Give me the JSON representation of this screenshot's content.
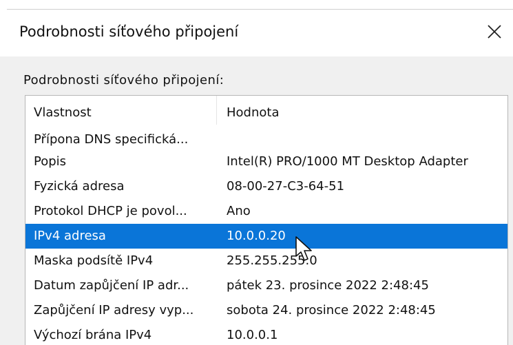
{
  "window": {
    "title": "Podrobnosti síťového připojení",
    "close_icon": "close-icon"
  },
  "group": {
    "label": "Podrobnosti síťového připojení:"
  },
  "table": {
    "columns": [
      "Vlastnost",
      "Hodnota"
    ],
    "rows": [
      {
        "property": "Přípona DNS specifická...",
        "value": ""
      },
      {
        "property": "Popis",
        "value": "Intel(R) PRO/1000 MT Desktop Adapter"
      },
      {
        "property": "Fyzická adresa",
        "value": "08-00-27-C3-64-51"
      },
      {
        "property": "Protokol DHCP je povol...",
        "value": "Ano"
      },
      {
        "property": "IPv4 adresa",
        "value": "10.0.0.20"
      },
      {
        "property": "Maska podsítě IPv4",
        "value": "255.255.255.0"
      },
      {
        "property": "Datum zapůjčení IP adr...",
        "value": "pátek 23. prosince 2022 2:48:45"
      },
      {
        "property": "Zapůjčení IP adresy vyp...",
        "value": "sobota 24. prosince 2022 2:48:45"
      },
      {
        "property": "Výchozí brána IPv4",
        "value": "10.0.0.1"
      }
    ],
    "selected_row": "IPv4 adresa"
  },
  "colors": {
    "selection": "#0a75d8",
    "window_background": "#ffffff",
    "dialog_background": "#f0f0f0"
  }
}
